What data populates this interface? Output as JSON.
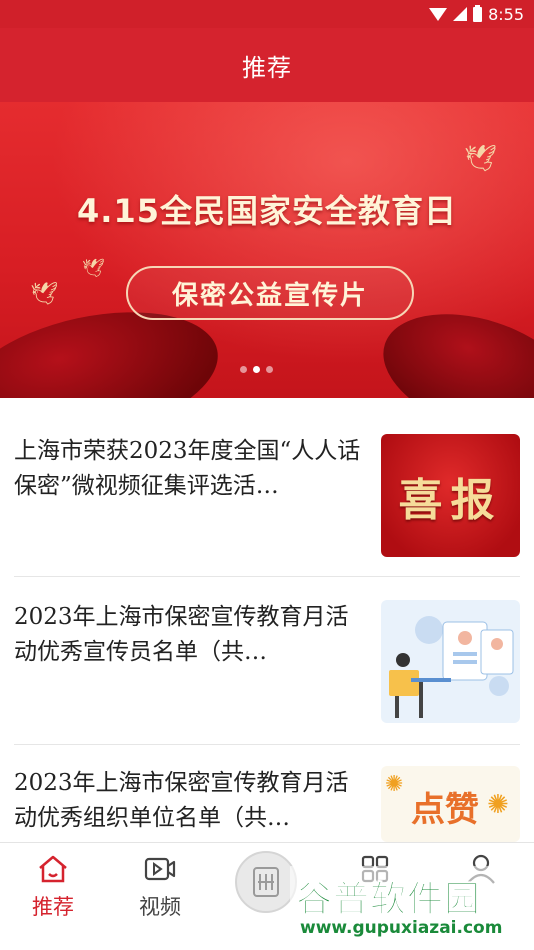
{
  "status_bar": {
    "time": "8:55"
  },
  "header": {
    "title": "推荐"
  },
  "banner": {
    "headline": "4.15全民国家安全教育日",
    "subtitle": "保密公益宣传片",
    "slide_index": 2,
    "slide_count": 3
  },
  "news": [
    {
      "title": "上海市荣获2023年度全国“人人话保密”微视频征集评选活…",
      "thumb_text": "喜报"
    },
    {
      "title": "2023年上海市保密宣传教育月活动优秀宣传员名单（共…"
    },
    {
      "title": "2023年上海市保密宣传教育月活动优秀组织单位名单（共…",
      "thumb_text": "点赞"
    }
  ],
  "tabbar": {
    "items": [
      {
        "label": "推荐",
        "icon": "home-icon",
        "active": true
      },
      {
        "label": "视频",
        "icon": "video-icon",
        "active": false
      },
      {
        "label": "",
        "icon": "center-logo-icon",
        "active": false
      },
      {
        "label": "",
        "icon": "grid-icon",
        "active": false
      },
      {
        "label": "",
        "icon": "user-icon",
        "active": false
      }
    ]
  },
  "watermark": {
    "name": "谷普软件园",
    "url": "www.gupuxiazai.com"
  },
  "colors": {
    "brand_red": "#d5232e"
  }
}
